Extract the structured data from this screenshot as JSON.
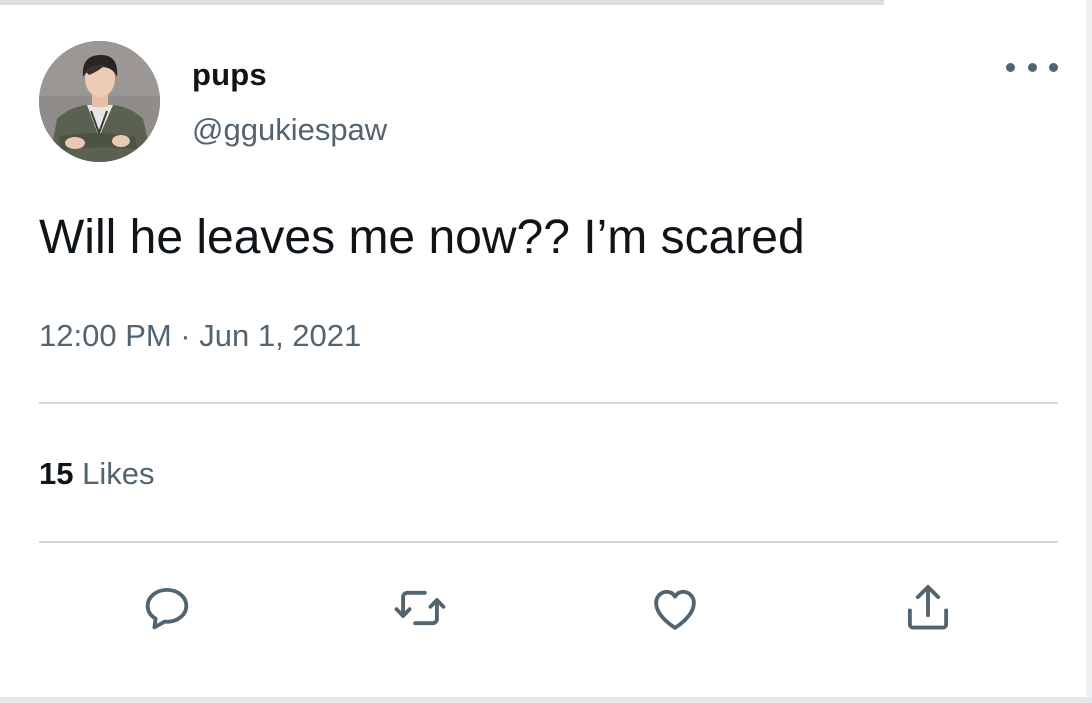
{
  "tweet": {
    "author": {
      "display_name": "pups",
      "handle": "@ggukiespaw"
    },
    "text": "Will he leaves me now?? I’m scared",
    "timestamp": "12:00 PM · Jun 1, 2021",
    "likes": {
      "count": "15",
      "label": "Likes"
    }
  },
  "icons": {
    "more": "more-icon",
    "reply": "reply-icon",
    "retweet": "retweet-icon",
    "like": "heart-icon",
    "share": "share-icon"
  },
  "colors": {
    "text_primary": "#0f1419",
    "text_secondary": "#536471",
    "divider": "#cfd9de",
    "icon": "#536471"
  }
}
